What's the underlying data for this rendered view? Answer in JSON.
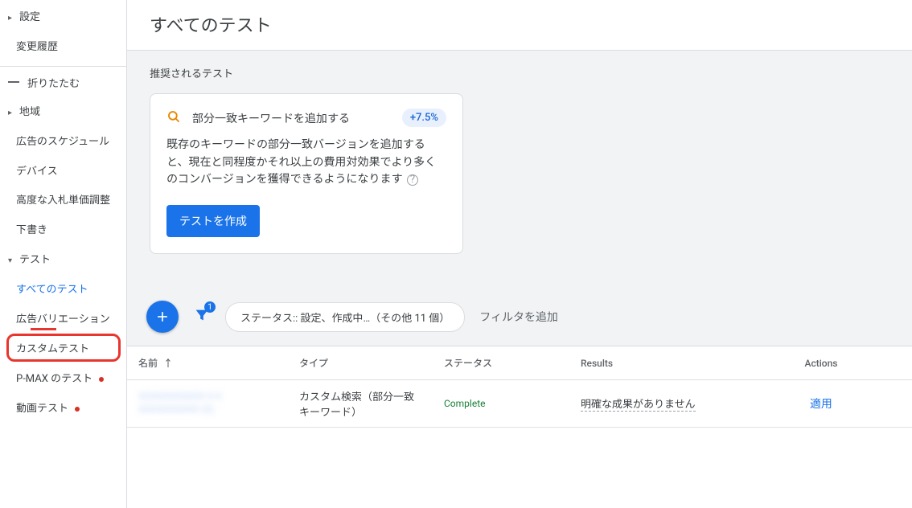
{
  "sidebar": {
    "settings": "設定",
    "change_history": "変更履歴",
    "collapse": "折りたたむ",
    "region": "地域",
    "ad_schedule": "広告のスケジュール",
    "device": "デバイス",
    "advanced_bid": "高度な入札単価調整",
    "draft": "下書き",
    "test": "テスト",
    "all_tests": "すべてのテスト",
    "ad_variations": "広告バリエーション",
    "custom_test": "カスタムテスト",
    "pmax_test": "P-MAX のテスト",
    "video_test": "動画テスト"
  },
  "page_title": "すべてのテスト",
  "rec": {
    "label": "推奨されるテスト",
    "card_title": "部分一致キーワードを追加する",
    "pct": "+7.5%",
    "desc": "既存のキーワードの部分一致バージョンを追加すると、現在と同程度かそれ以上の費用対効果でより多くのコンバージョンを獲得できるようになります",
    "create_btn": "テストを作成"
  },
  "filter": {
    "badge": "1",
    "chip": "ステータス:: 設定、作成中…（その他 11 個）",
    "add": "フィルタを追加"
  },
  "table": {
    "headers": {
      "name": "名前",
      "type": "タイプ",
      "status": "ステータス",
      "results": "Results",
      "actions": "Actions"
    },
    "rows": [
      {
        "name_blur1": "XXXXXXXXXXX X X",
        "name_blur2": "XXXXXXXXXX (X)",
        "type": "カスタム検索（部分一致キーワード）",
        "status": "Complete",
        "results": "明確な成果がありません",
        "action": "適用"
      }
    ]
  }
}
